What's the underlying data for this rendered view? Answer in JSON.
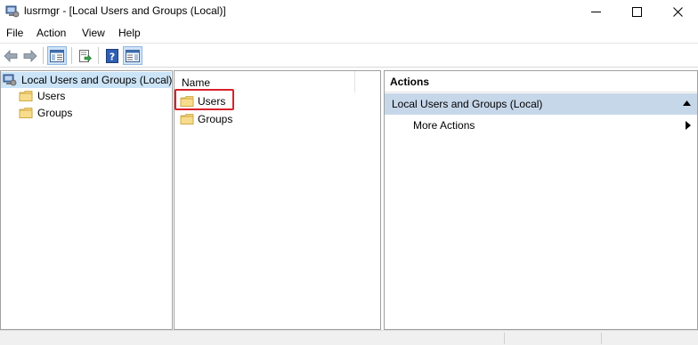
{
  "window": {
    "title": "lusrmgr - [Local Users and Groups (Local)]"
  },
  "menu": [
    "File",
    "Action",
    "View",
    "Help"
  ],
  "toolbar": {
    "icons": [
      "back-arrow-icon",
      "forward-arrow-icon",
      "show-hide-console-tree-icon",
      "export-list-icon",
      "help-icon",
      "show-hide-action-pane-icon"
    ]
  },
  "tree": {
    "root": "Local Users and Groups (Local)",
    "children": [
      "Users",
      "Groups"
    ]
  },
  "list": {
    "column": "Name",
    "items": [
      "Users",
      "Groups"
    ]
  },
  "actions": {
    "title": "Actions",
    "group": "Local Users and Groups (Local)",
    "item": "More Actions"
  },
  "colors": {
    "selection": "#cce4f7",
    "action_group": "#c7d7ea",
    "highlight": "#d9222a",
    "folder": "#f3d27a"
  }
}
